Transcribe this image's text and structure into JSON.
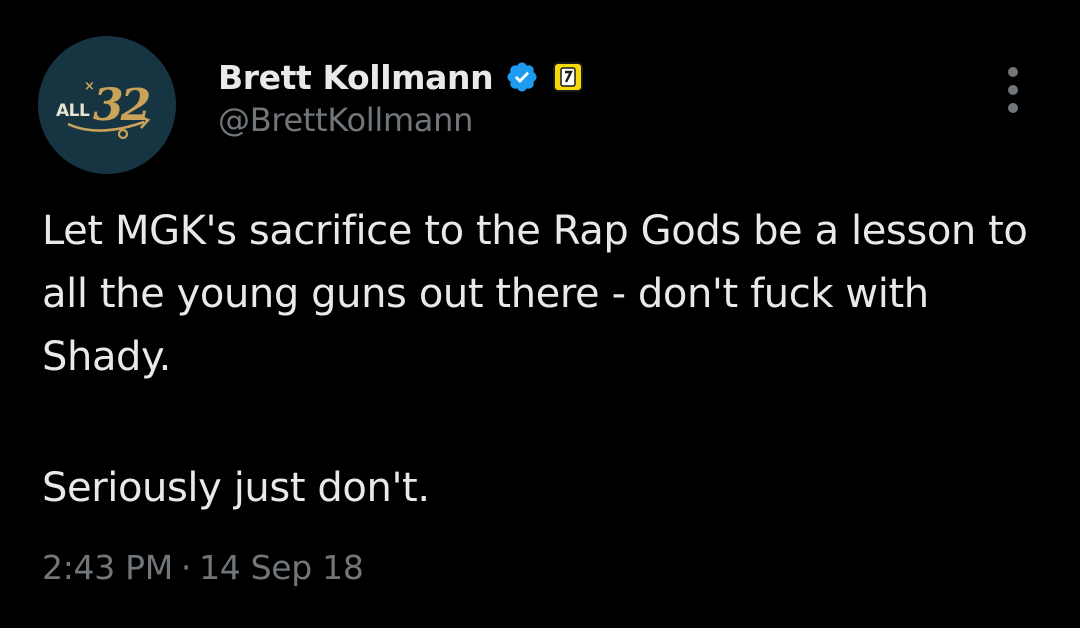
{
  "author": {
    "display_name": "Brett Kollmann",
    "handle": "@BrettKollmann",
    "avatar_text": "ALL 32",
    "verified": true,
    "verified_color": "#1d9bf0",
    "affiliate_badge_color": "#f5d90a"
  },
  "tweet": {
    "text": "Let MGK's sacrifice to the Rap Gods be a lesson to all the young guns out there - don't fuck with Shady.",
    "text_line2": "Seriously just don't."
  },
  "meta": {
    "time": "2:43 PM",
    "separator": "·",
    "date": "14 Sep 18"
  },
  "icons": {
    "more": "more-vertical-icon",
    "verified": "verified-badge-icon",
    "affiliate": "affiliate-badge-icon"
  }
}
